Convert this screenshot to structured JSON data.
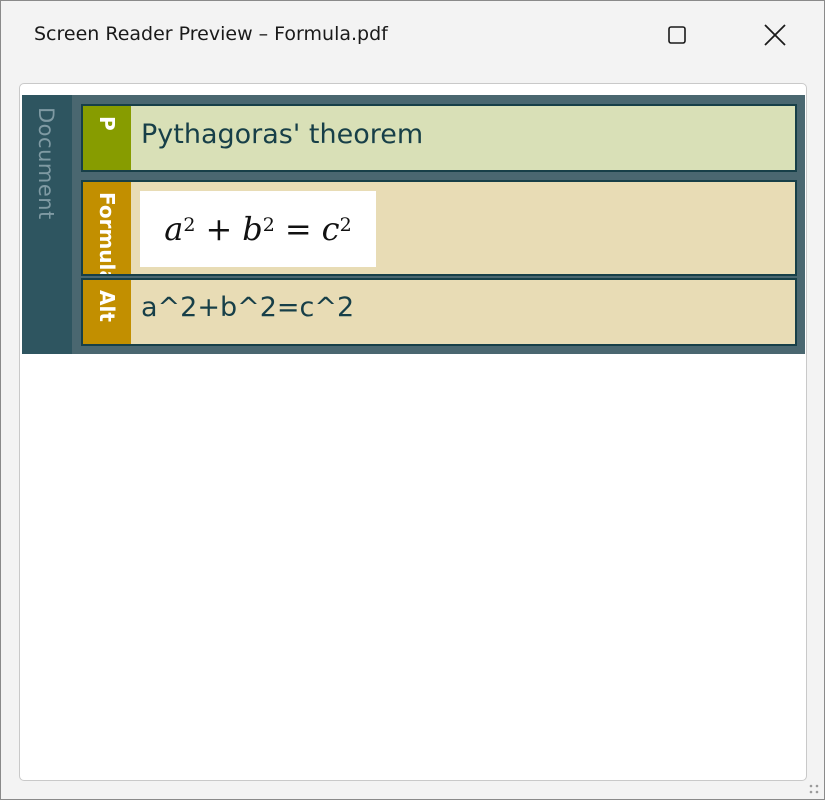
{
  "window": {
    "title": "Screen Reader Preview – Formula.pdf",
    "buttons": {
      "maximize_icon": "maximize-icon",
      "close_icon": "close-icon"
    }
  },
  "tree": {
    "root_label": "Document",
    "nodes": [
      {
        "tag": "P",
        "text": "Pythagoras' theorem"
      },
      {
        "tag": "Formula",
        "formula": {
          "a": "a",
          "b": "b",
          "c": "c",
          "exp": "2",
          "plus": "+",
          "eq": "="
        }
      },
      {
        "tag": "Alt",
        "text": "a^2+b^2=c^2"
      }
    ]
  },
  "colors": {
    "root_bg": "#2e5560",
    "paragraph_tag": "#879c00",
    "paragraph_bg": "#d9e0b7",
    "formula_tag": "#c28f00",
    "formula_bg": "#e8dcb5",
    "text": "#173f48"
  }
}
